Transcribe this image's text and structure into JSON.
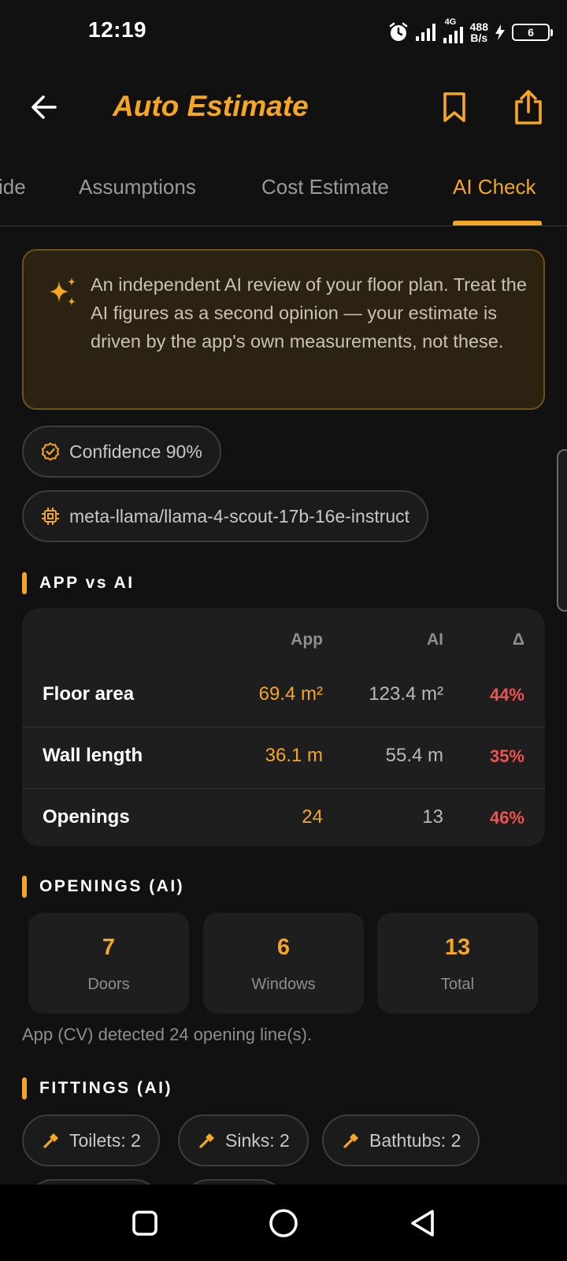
{
  "status_bar": {
    "time": "12:19",
    "network_label": "4G",
    "speed_value": "488",
    "speed_unit": "B/s",
    "battery_level": "6"
  },
  "app_bar": {
    "title": "Auto Estimate",
    "back_icon": "arrow-left-icon",
    "bookmark_icon": "bookmark-icon",
    "share_icon": "share-icon"
  },
  "tabs": [
    {
      "label": "ide",
      "active": false
    },
    {
      "label": "Assumptions",
      "active": false
    },
    {
      "label": "Cost Estimate",
      "active": false
    },
    {
      "label": "AI Check",
      "active": true
    }
  ],
  "info": {
    "icon": "sparkle-icon",
    "text": "An independent AI review of your floor plan. Treat the AI figures as a second opinion — your estimate is driven by the app's own measurements, not these."
  },
  "chips": {
    "confidence": "Confidence 90%",
    "model": "meta-llama/llama-4-scout-17b-16e-instruct"
  },
  "compare": {
    "section_title": "APP vs AI",
    "headers": {
      "app": "App",
      "ai": "AI",
      "delta": "Δ"
    },
    "rows": [
      {
        "label": "Floor area",
        "app": "69.4 m²",
        "ai": "123.4 m²",
        "delta": "44%"
      },
      {
        "label": "Wall length",
        "app": "36.1 m",
        "ai": "55.4 m",
        "delta": "35%"
      },
      {
        "label": "Openings",
        "app": "24",
        "ai": "13",
        "delta": "46%"
      }
    ]
  },
  "openings": {
    "section_title": "OPENINGS (AI)",
    "tiles": [
      {
        "value": "7",
        "label": "Doors"
      },
      {
        "value": "6",
        "label": "Windows"
      },
      {
        "value": "13",
        "label": "Total"
      }
    ],
    "note": "App (CV) detected 24 opening line(s)."
  },
  "fittings": {
    "section_title": "FITTINGS (AI)",
    "items": [
      {
        "label": "Toilets: 2"
      },
      {
        "label": "Sinks: 2"
      },
      {
        "label": "Bathtubs: 2"
      }
    ]
  },
  "colors": {
    "accent": "#f5a623",
    "background": "#111111",
    "card": "#1e1e1e",
    "delta_red": "#ef5350"
  }
}
